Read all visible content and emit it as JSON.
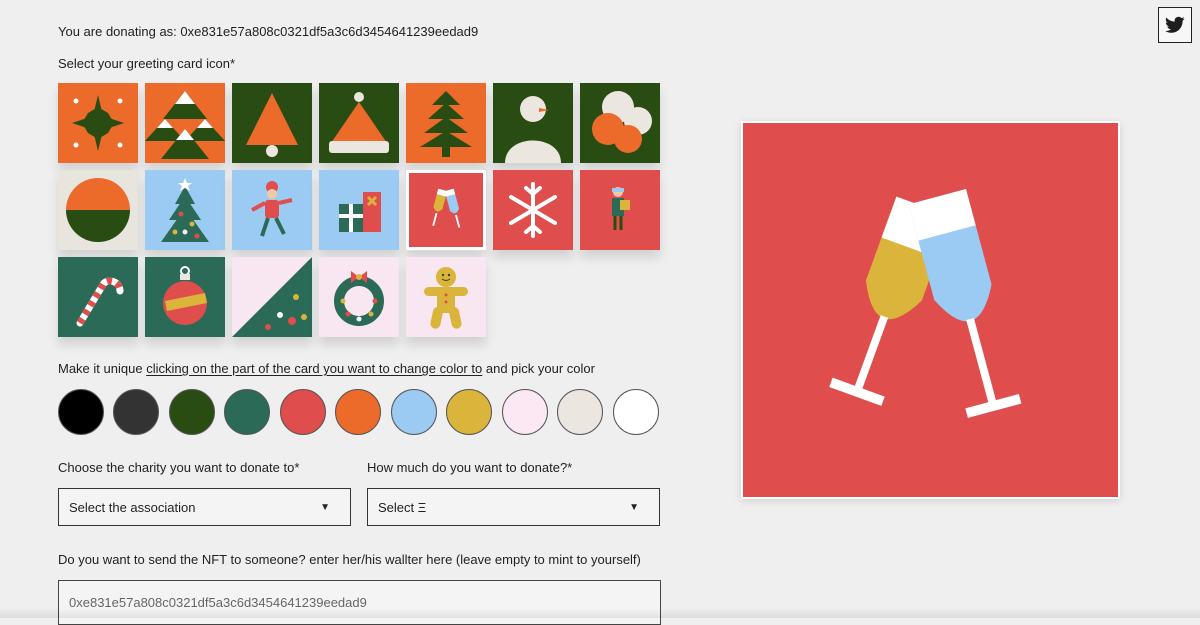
{
  "donor": {
    "label": "You are donating as: 0xe831e57a808c0321df5a3c6d3454641239eedad9"
  },
  "select_icon": {
    "title": "Select your greeting card icon*",
    "icons": [
      {
        "name": "star",
        "bg": "#ec6a2a"
      },
      {
        "name": "snowy-mountain",
        "bg": "#ec6a2a"
      },
      {
        "name": "tree-bell",
        "bg": "#284c12"
      },
      {
        "name": "santa-hat",
        "bg": "#284c12"
      },
      {
        "name": "layered-tree",
        "bg": "#ec6a2a"
      },
      {
        "name": "snowman",
        "bg": "#284c12"
      },
      {
        "name": "circles",
        "bg": "#284c12"
      },
      {
        "name": "sunset",
        "bg": "#e8e4de"
      },
      {
        "name": "decorated-tree",
        "bg": "#9bcbf3"
      },
      {
        "name": "elf",
        "bg": "#9bcbf3"
      },
      {
        "name": "gifts",
        "bg": "#9bcbf3"
      },
      {
        "name": "champagne-glasses",
        "bg": "#e04d4d",
        "selected": true
      },
      {
        "name": "snowflake",
        "bg": "#e04d4d"
      },
      {
        "name": "kid-with-gift",
        "bg": "#e04d4d"
      },
      {
        "name": "candy-cane",
        "bg": "#2a6a56"
      },
      {
        "name": "ornament",
        "bg": "#2a6a56"
      },
      {
        "name": "diagonal-tree",
        "bg": "#f8e6f0"
      },
      {
        "name": "wreath",
        "bg": "#f8e6f0"
      },
      {
        "name": "gingerbread",
        "bg": "#f8e6f0"
      }
    ]
  },
  "unique": {
    "prefix": "Make it unique",
    "link": "clicking on the part of the card you want to change color to",
    "suffix": "and pick your color"
  },
  "swatches": [
    "#000000",
    "#333333",
    "#284c12",
    "#2a6a56",
    "#e04d4d",
    "#ec6a2a",
    "#9bcbf3",
    "#dbb43b",
    "#fbe8f2",
    "#ebe6df",
    "#ffffff"
  ],
  "charity": {
    "label": "Choose the charity you want to donate to*",
    "selected": "Select the association"
  },
  "amount": {
    "label": "How much do you want to donate?*",
    "selected": "Select Ξ"
  },
  "recipient": {
    "label": "Do you want to send the NFT to someone? enter her/his wallter here (leave empty to mint to yourself)",
    "value": "0xe831e57a808c0321df5a3c6d3454641239eedad9"
  },
  "preview": {
    "icon": "champagne-glasses",
    "bg": "#e04d4d",
    "glass_left": "#dbb43b",
    "glass_right": "#9bcbf3"
  },
  "twitter_icon": "twitter-icon"
}
